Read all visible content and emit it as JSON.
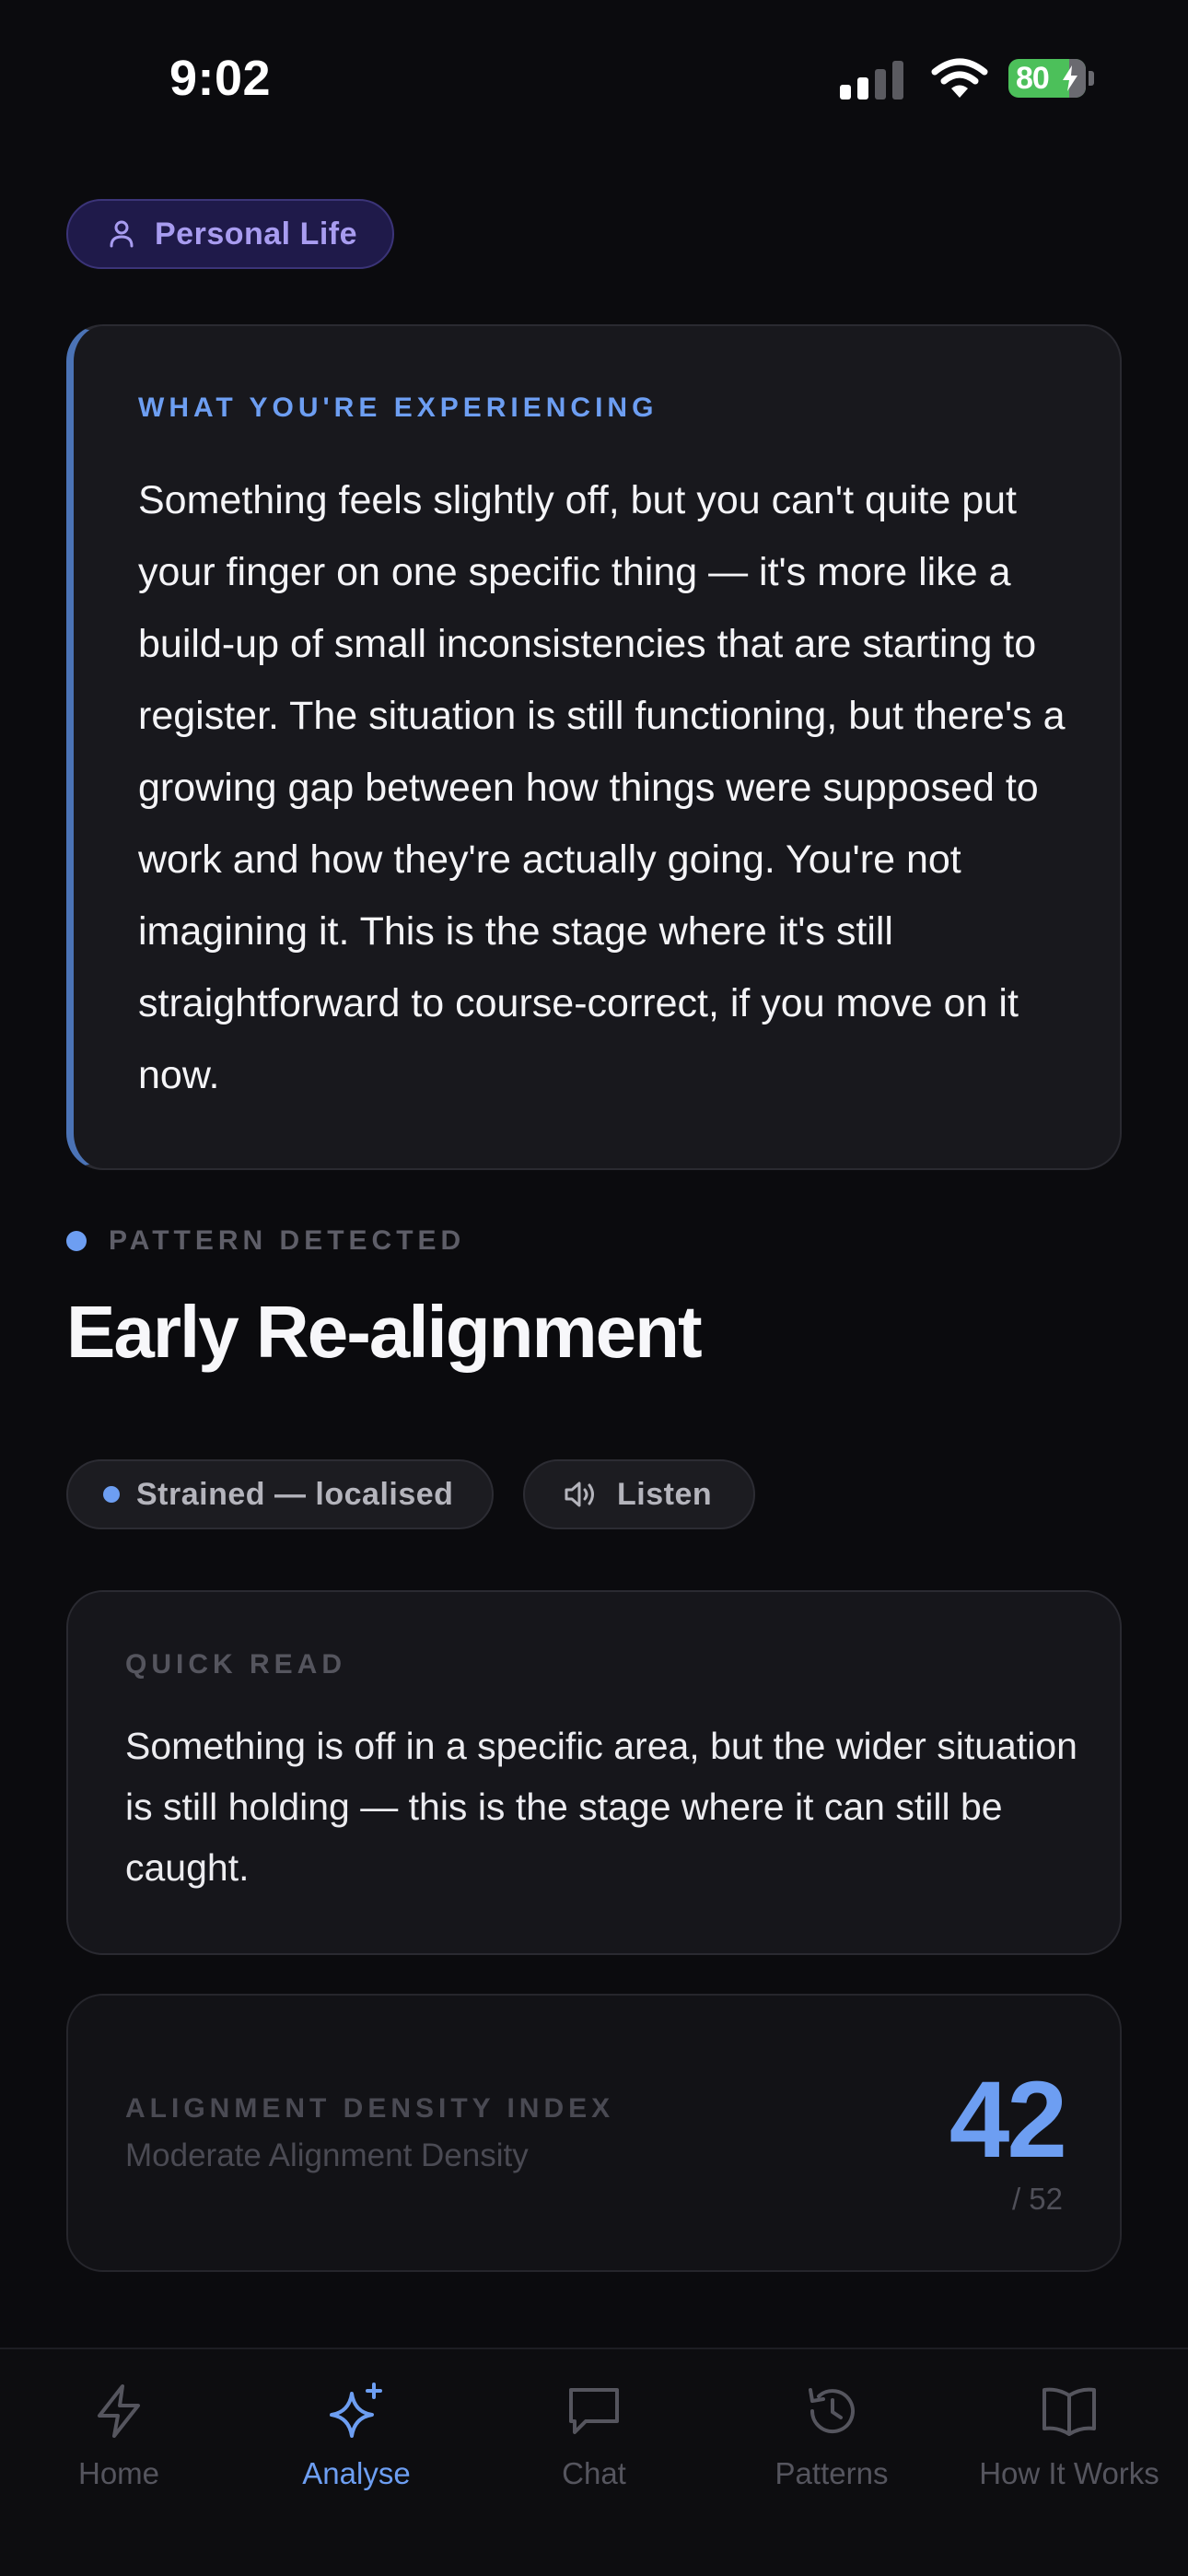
{
  "status_bar": {
    "time": "9:02",
    "battery": "80"
  },
  "category": {
    "label": "Personal Life",
    "icon": "person-icon"
  },
  "experience": {
    "heading": "WHAT YOU'RE EXPERIENCING",
    "body": "Something feels slightly off, but you can't quite put your finger on one specific thing — it's more like a build-up of small inconsistencies that are starting to register. The situation is still functioning, but there's a growing gap between how things were supposed to work and how they're actually going. You're not imagining it. This is the stage where it's still straightforward to course-correct, if you move on it now."
  },
  "pattern": {
    "label": "PATTERN DETECTED",
    "title": "Early Re-alignment",
    "status_chip": "Strained — localised",
    "listen_chip": "Listen"
  },
  "quick_read": {
    "heading": "QUICK READ",
    "body": "Something is off in a specific area, but the wider situation is still holding — this is the stage where it can still be caught."
  },
  "density": {
    "heading": "ALIGNMENT DENSITY INDEX",
    "subtitle": "Moderate Alignment Density",
    "score": "42",
    "max": "/ 52"
  },
  "tabs": [
    {
      "label": "Home",
      "icon": "bolt-icon",
      "active": false
    },
    {
      "label": "Analyse",
      "icon": "sparkle-icon",
      "active": true
    },
    {
      "label": "Chat",
      "icon": "chat-bubble-icon",
      "active": false
    },
    {
      "label": "Patterns",
      "icon": "history-icon",
      "active": false
    },
    {
      "label": "How It Works",
      "icon": "book-icon",
      "active": false
    }
  ],
  "colors": {
    "accent": "#6d9ef2",
    "category_text": "#a89cf0",
    "category_bg": "#1f1a4a",
    "background": "#0b0b0e",
    "battery": "#4cc05a"
  }
}
